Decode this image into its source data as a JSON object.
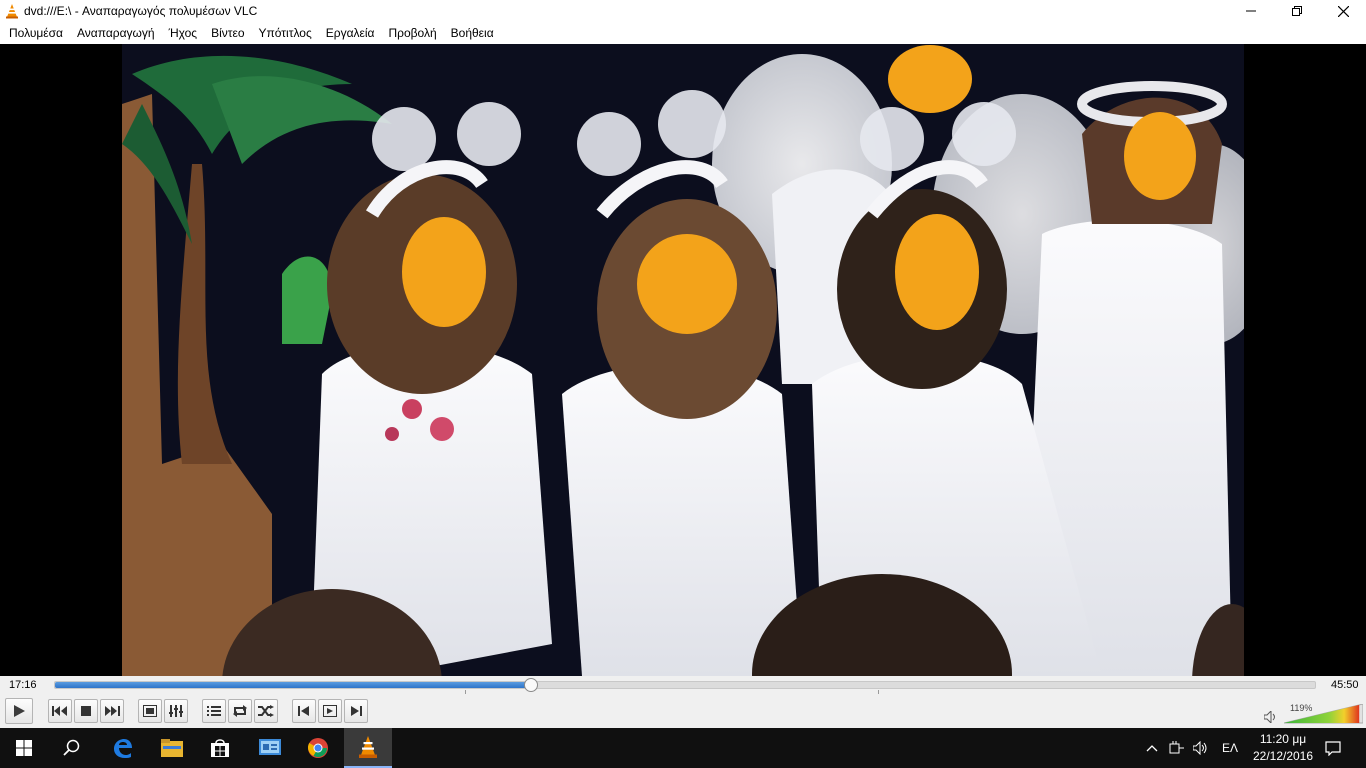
{
  "window": {
    "title": "dvd:///E:\\ - Αναπαραγωγός πολυμέσων VLC"
  },
  "menu": {
    "items": [
      "Πολυμέσα",
      "Αναπαραγωγή",
      "Ήχος",
      "Βίντεο",
      "Υπότιτλος",
      "Εργαλεία",
      "Προβολή",
      "Βοήθεια"
    ]
  },
  "player": {
    "elapsed": "17:16",
    "total": "45:50",
    "progress": 0.3768,
    "chapter_marks": [
      0.326,
      0.653
    ],
    "volume_percent": "119%",
    "volume_level": 1.19
  },
  "taskbar": {
    "apps": [
      "start-icon",
      "search-icon",
      "edge-icon",
      "file-explorer-icon",
      "store-icon",
      "control-panel-icon",
      "chrome-icon",
      "vlc-icon"
    ],
    "language": "ΕΛ",
    "time": "11:20 μμ",
    "date": "22/12/2016"
  },
  "colors": {
    "accent": "#2e74c9",
    "vlc_orange": "#f08a00",
    "taskbar": "#101010"
  }
}
